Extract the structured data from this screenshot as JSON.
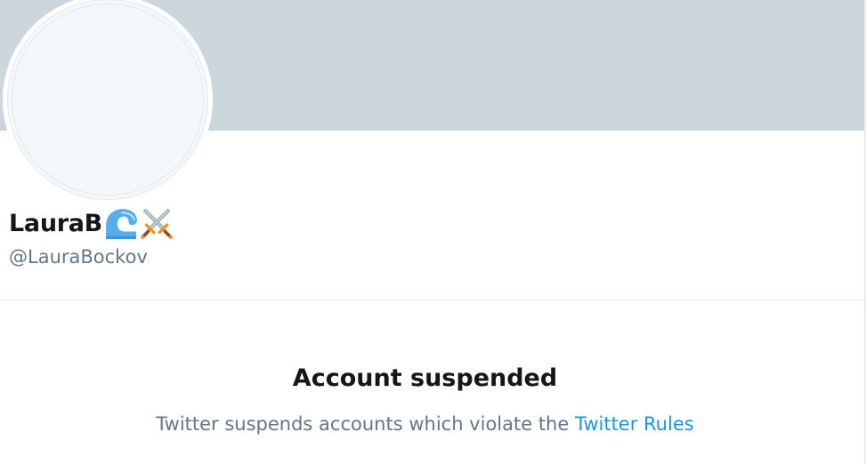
{
  "profile": {
    "display_name": "LauraB",
    "name_emojis": [
      "water-wave-emoji",
      "crossed-swords-emoji"
    ],
    "handle": "@LauraBockov"
  },
  "notice": {
    "title": "Account suspended",
    "text_prefix": "Twitter suspends accounts which violate the ",
    "link_label": "Twitter Rules"
  },
  "colors": {
    "banner": "#ccd6dd",
    "avatar_bg": "#f5f8fa",
    "primary_text": "#14171a",
    "secondary_text": "#657786",
    "link": "#1b95e0",
    "divider": "#e6ecf0"
  }
}
